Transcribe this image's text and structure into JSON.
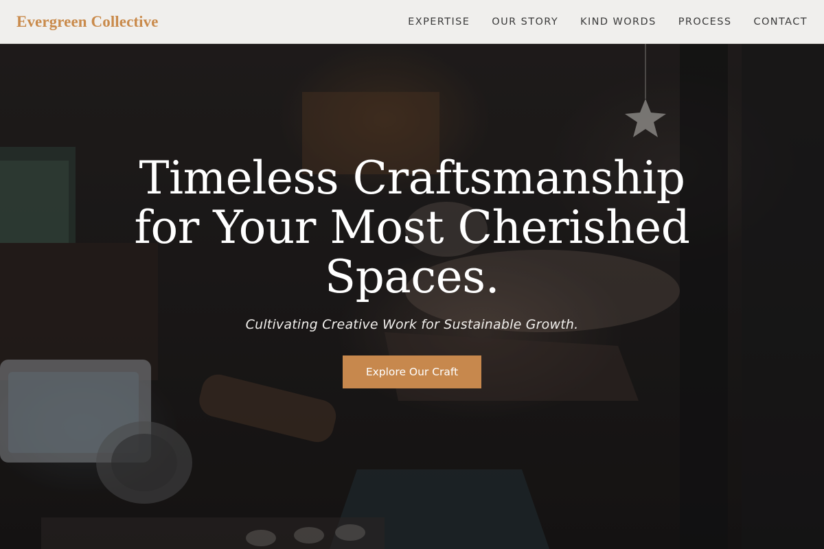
{
  "header": {
    "brand": "Evergreen Collective",
    "nav": [
      {
        "label": "EXPERTISE"
      },
      {
        "label": "OUR STORY"
      },
      {
        "label": "KIND WORDS"
      },
      {
        "label": "PROCESS"
      },
      {
        "label": "CONTACT"
      }
    ]
  },
  "hero": {
    "title": "Timeless Craftsmanship for Your Most Cherished Spaces.",
    "subtitle": "Cultivating Creative Work for Sustainable Growth.",
    "cta_label": "Explore Our Craft"
  },
  "colors": {
    "brand": "#c98a4b",
    "cta": "#c7884d",
    "header_bg": "#f0efed",
    "nav_text": "#3a3a3a"
  }
}
